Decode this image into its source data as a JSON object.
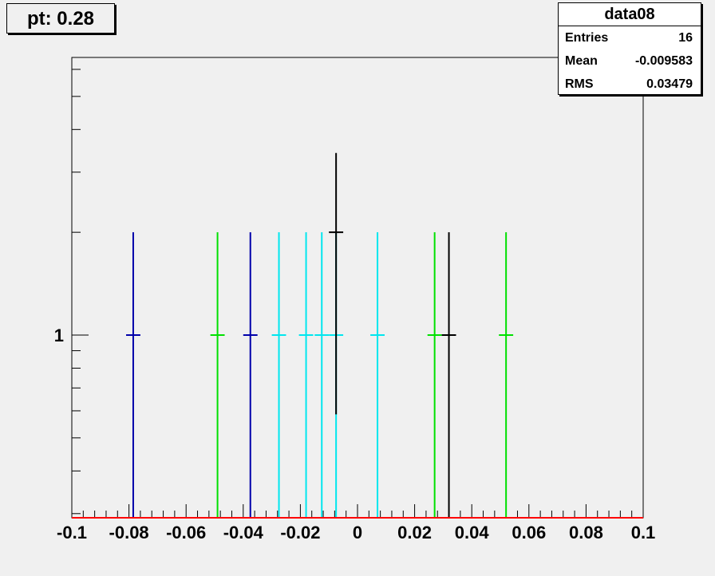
{
  "title": "pt: 0.28",
  "stats": {
    "name": "data08",
    "rows": [
      {
        "label": "Entries",
        "value": "16"
      },
      {
        "label": "Mean",
        "value": "-0.009583"
      },
      {
        "label": "RMS",
        "value": "0.03479"
      }
    ]
  },
  "colors": {
    "blue": "#0000aa",
    "green": "#00e000",
    "cyan": "#00e6ee",
    "black": "#000000",
    "baseline": "#ff0000"
  },
  "chart_data": {
    "type": "scatter",
    "xlim": [
      -0.1,
      0.1
    ],
    "y_scale": "log",
    "x_tick_labels": [
      "-0.1",
      "-0.08",
      "-0.06",
      "-0.04",
      "-0.02",
      "0",
      "0.02",
      "0.04",
      "0.06",
      "0.08",
      "0.1"
    ],
    "x_ticks": [
      -0.1,
      -0.08,
      -0.06,
      -0.04,
      -0.02,
      0,
      0.02,
      0.04,
      0.06,
      0.08,
      0.1
    ],
    "y_tick_labels": [
      "1"
    ],
    "y_ticks": [
      1
    ],
    "points": [
      {
        "x": -0.0785,
        "y": 1,
        "color": "blue"
      },
      {
        "x": -0.049,
        "y": 1,
        "color": "green"
      },
      {
        "x": -0.0375,
        "y": 1,
        "color": "blue"
      },
      {
        "x": -0.0275,
        "y": 1,
        "color": "cyan"
      },
      {
        "x": -0.018,
        "y": 1,
        "color": "cyan"
      },
      {
        "x": -0.0125,
        "y": 1,
        "color": "cyan"
      },
      {
        "x": -0.0075,
        "y": 1,
        "color": "cyan"
      },
      {
        "x": -0.0075,
        "y": 2,
        "color": "black"
      },
      {
        "x": 0.007,
        "y": 1,
        "color": "cyan"
      },
      {
        "x": 0.027,
        "y": 1,
        "color": "green"
      },
      {
        "x": 0.032,
        "y": 1,
        "color": "black"
      },
      {
        "x": 0.052,
        "y": 1,
        "color": "green"
      }
    ]
  }
}
